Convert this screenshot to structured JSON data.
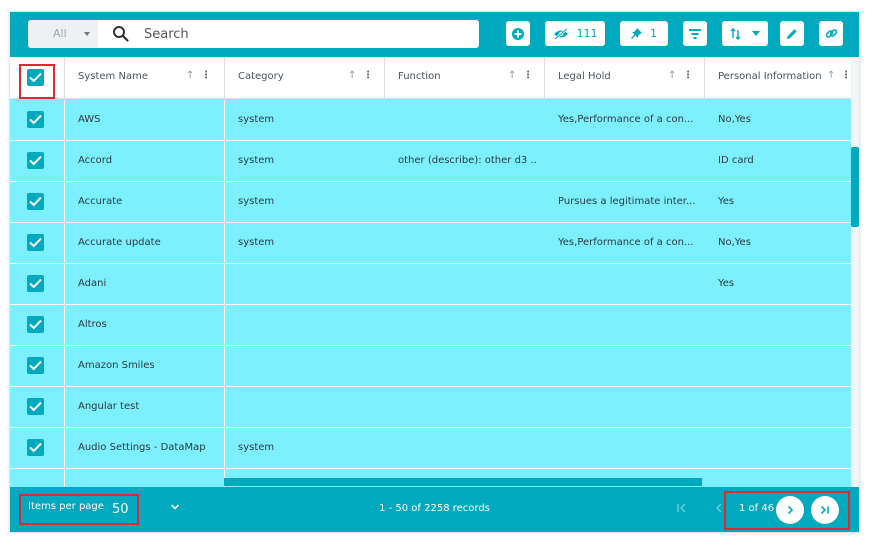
{
  "toolbar": {
    "scope": "All",
    "search_placeholder": "Search",
    "hidden_count": "111",
    "pinned_count": "1"
  },
  "table": {
    "columns": [
      {
        "label": "System Name"
      },
      {
        "label": "Category"
      },
      {
        "label": "Function"
      },
      {
        "label": "Legal Hold"
      },
      {
        "label": "Personal Information"
      }
    ],
    "rows": [
      {
        "name": "AWS",
        "category": "system",
        "function": "",
        "legal_hold": "Yes,Performance of a con...",
        "personal_info": "No,Yes"
      },
      {
        "name": "Accord",
        "category": "system",
        "function": "other (describe): other d3 ...",
        "legal_hold": "",
        "personal_info": "ID card"
      },
      {
        "name": "Accurate",
        "category": "system",
        "function": "",
        "legal_hold": "Pursues a legitimate inter...",
        "personal_info": "Yes"
      },
      {
        "name": "Accurate update",
        "category": "system",
        "function": "",
        "legal_hold": "Yes,Performance of a con...",
        "personal_info": "No,Yes"
      },
      {
        "name": "Adani",
        "category": "",
        "function": "",
        "legal_hold": "",
        "personal_info": "Yes"
      },
      {
        "name": "Altros",
        "category": "",
        "function": "",
        "legal_hold": "",
        "personal_info": ""
      },
      {
        "name": "Amazon Smiles",
        "category": "",
        "function": "",
        "legal_hold": "",
        "personal_info": ""
      },
      {
        "name": "Angular test",
        "category": "",
        "function": "",
        "legal_hold": "",
        "personal_info": ""
      },
      {
        "name": "Audio Settings - DataMap",
        "category": "system",
        "function": "",
        "legal_hold": "",
        "personal_info": ""
      }
    ]
  },
  "footer": {
    "items_per_page_label": "Items per page",
    "items_per_page_value": "50",
    "records_text": "1 - 50 of 2258 records",
    "page_text": "1 of 46"
  },
  "colors": {
    "accent": "#00a9bd",
    "row_selected": "#7df0ff",
    "highlight": "#e0262f"
  }
}
